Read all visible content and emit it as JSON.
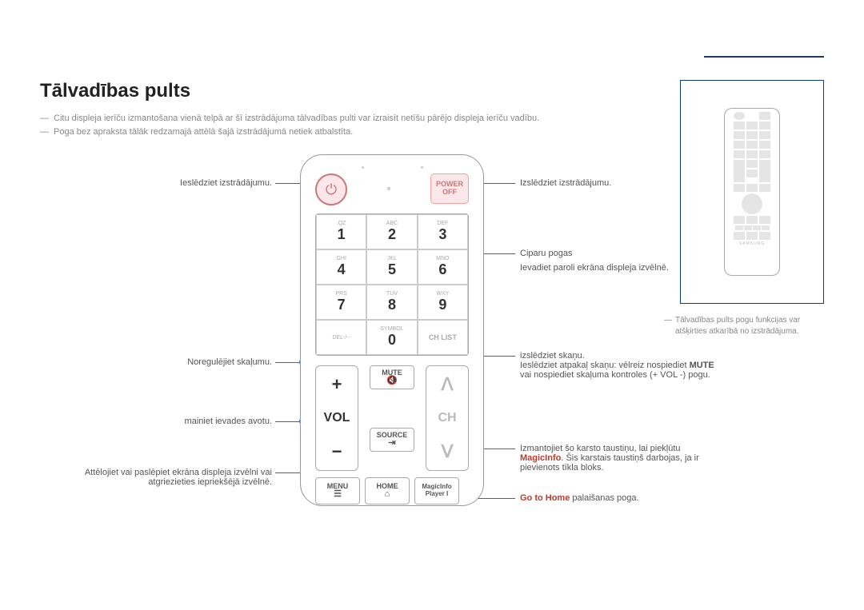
{
  "title": "Tālvadības pults",
  "intro": {
    "line1": "Citu displeja ierīču izmantošana vienā telpā ar šī izstrādājuma tālvadības pulti var izraisīt netīšu pārējo displeja ierīču vadību.",
    "line2": "Poga bez apraksta tālāk redzamajā attēlā šajā izstrādājumā netiek atbalstīta."
  },
  "side_note": "Tālvadības pults pogu funkcijas var atšķirties atkarībā no izstrādājuma.",
  "remote": {
    "power_on_icon": "⏻",
    "power_off_top": "POWER",
    "power_off_bot": "OFF",
    "numpad": [
      {
        "sub": ".QZ",
        "num": "1"
      },
      {
        "sub": "ABC",
        "num": "2"
      },
      {
        "sub": "DEF",
        "num": "3"
      },
      {
        "sub": "GHI",
        "num": "4"
      },
      {
        "sub": "JKL",
        "num": "5"
      },
      {
        "sub": "MNO",
        "num": "6"
      },
      {
        "sub": "PRS",
        "num": "7"
      },
      {
        "sub": "TUV",
        "num": "8"
      },
      {
        "sub": "WXY",
        "num": "9"
      },
      {
        "sub": "DEL-/--",
        "num": ""
      },
      {
        "sub": "SYMBOL",
        "num": "0"
      },
      {
        "sub": "",
        "num": "CH LIST"
      }
    ],
    "vol": {
      "plus": "+",
      "label": "VOL",
      "minus": "−"
    },
    "ch": {
      "up": "ᐱ",
      "label": "CH",
      "down": "ᐯ"
    },
    "mute": "MUTE",
    "mute_glyph": "🔇",
    "source": "SOURCE",
    "source_glyph": "⇥",
    "menu": "MENU",
    "menu_glyph": "☰",
    "home": "HOME",
    "home_glyph": "⌂",
    "magic_top": "MagicInfo",
    "magic_bot": "Player I"
  },
  "labels": {
    "left": {
      "l1": "Ieslēdziet izstrādājumu.",
      "l2": "Noregulējiet skaļumu.",
      "l3": "mainiet ievades avotu.",
      "l4a": "Attēlojiet vai paslēpiet ekrāna displeja izvēlni vai",
      "l4b": "atgriezieties iepriekšējā izvēlnē."
    },
    "right": {
      "r1": "Izslēdziet izstrādājumu.",
      "r2": "Ciparu pogas",
      "r2b": "Ievadiet paroli ekrāna displeja izvēlnē.",
      "r3": "izslēdziet skaņu.",
      "r3b_pre": "Ieslēdziet atpakaļ skaņu: vēlreiz nospiediet ",
      "r3b_mute": "MUTE",
      "r3c": "vai nospiediet skaļuma kontroles (+ VOL -) pogu.",
      "r4a": "Izmantojiet šo karsto taustiņu, lai piekļūtu",
      "r4b_pre": "MagicInfo",
      "r4b_post": ". Šis karstais taustiņš darbojas, ja ir",
      "r4c": "pievienots tīkla bloks.",
      "r5_pre": "Go to Home",
      "r5_post": " palaišanas poga."
    }
  },
  "brand": "SAMSUNG"
}
